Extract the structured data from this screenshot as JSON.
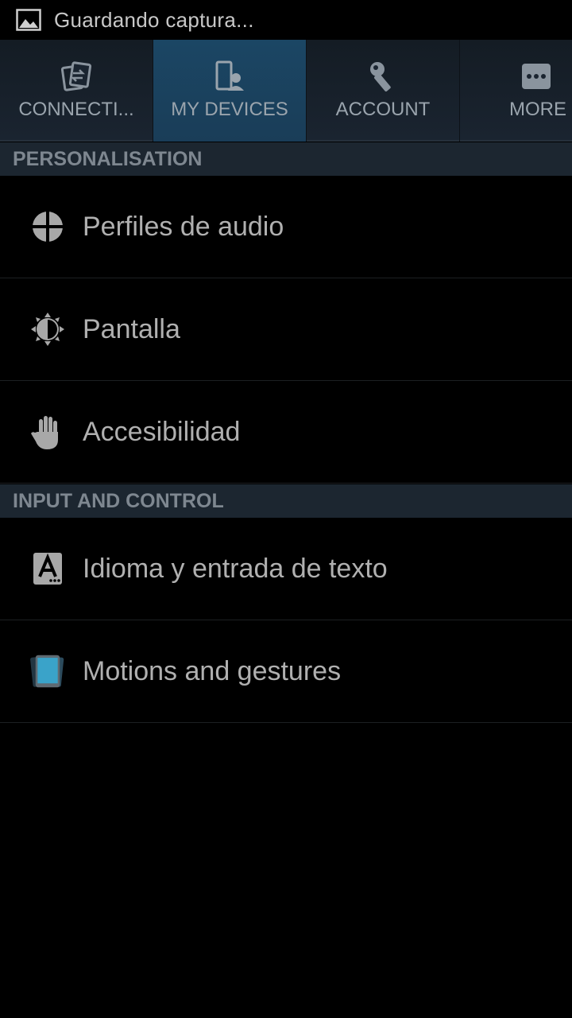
{
  "status_bar": {
    "notification_icon": "image-icon",
    "notification_text": "Guardando captura..."
  },
  "tabs": [
    {
      "label": "CONNECTI...",
      "icon": "connections-icon",
      "active": false
    },
    {
      "label": "MY DEVICES",
      "icon": "my-devices-icon",
      "active": true
    },
    {
      "label": "ACCOUNT",
      "icon": "key-icon",
      "active": false
    },
    {
      "label": "MORE",
      "icon": "more-icon",
      "active": false
    }
  ],
  "sections": [
    {
      "title": "PERSONALISATION",
      "items": [
        {
          "label": "Perfiles de audio",
          "icon": "sound-profile-icon"
        },
        {
          "label": "Pantalla",
          "icon": "display-icon"
        },
        {
          "label": "Accesibilidad",
          "icon": "hand-icon"
        }
      ]
    },
    {
      "title": "INPUT AND CONTROL",
      "items": [
        {
          "label": "Idioma y entrada de texto",
          "icon": "language-icon"
        },
        {
          "label": "Motions and gestures",
          "icon": "motions-icon"
        }
      ]
    }
  ],
  "colors": {
    "background": "#000000",
    "tab_bar": "#1a2430",
    "active_tab": "#1b4664",
    "section_header": "#1c2630",
    "text": "#b0b0b0"
  }
}
